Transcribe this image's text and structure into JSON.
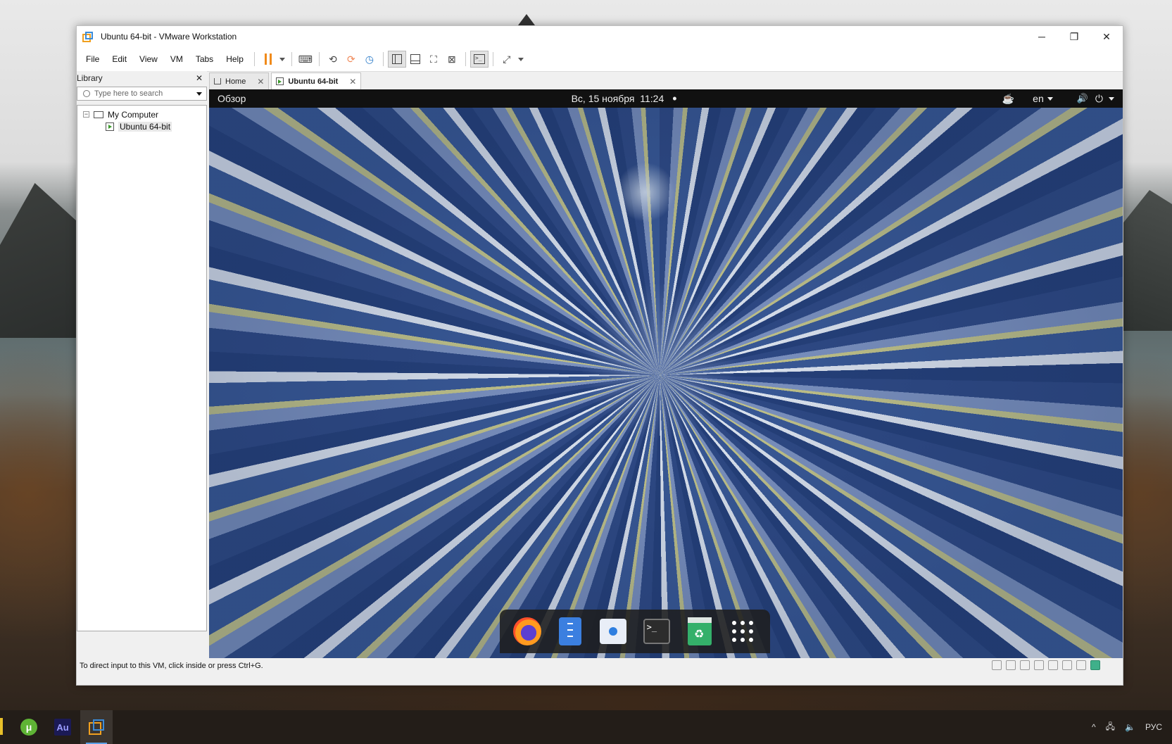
{
  "window": {
    "title": "Ubuntu 64-bit - VMware Workstation",
    "controls": [
      "─",
      "❐",
      "✕"
    ]
  },
  "menu": [
    "File",
    "Edit",
    "View",
    "VM",
    "Tabs",
    "Help"
  ],
  "library": {
    "title": "Library",
    "close": "✕",
    "search_placeholder": "Type here to search",
    "tree": {
      "toggle": "−",
      "root": "My Computer",
      "child": "Ubuntu 64-bit"
    }
  },
  "tabs": [
    {
      "label": "Home",
      "close": "✕"
    },
    {
      "label": "Ubuntu 64-bit",
      "close": "✕"
    }
  ],
  "gnome": {
    "activities": "Обзор",
    "datetime": "Вс, 15 ноября  11:24",
    "indicator": "•",
    "lang": "en",
    "volume_glyph": "🔊",
    "power_glyph": "⏻"
  },
  "dock": {
    "terminal_prompt": ">_",
    "icons": [
      "firefox-icon",
      "files-icon",
      "software-store-icon",
      "terminal-icon",
      "trash-icon",
      "show-apps-icon"
    ]
  },
  "status": {
    "hint": "To direct input to this VM, click inside or press Ctrl+G."
  },
  "taskbar": {
    "apps": [
      {
        "name": "utorrent",
        "glyph": "μ"
      },
      {
        "name": "audition",
        "glyph": "Au"
      },
      {
        "name": "vmware",
        "glyph": ""
      }
    ],
    "tray_chevron": "^",
    "language": "РУС"
  },
  "colors": {
    "accent": "#3a8bd9",
    "vmware_orange": "#f0a020",
    "pause_orange": "#f08a1a",
    "gnome_bar": "#111111",
    "taskbar": "#231d18"
  }
}
